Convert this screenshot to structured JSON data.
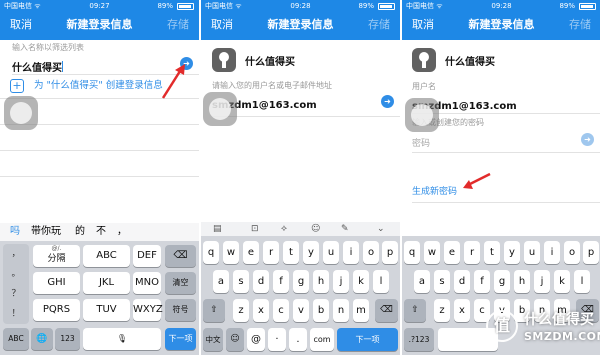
{
  "panels": [
    {
      "status": {
        "carrier": "中国电信 ᯤ",
        "time": "09:27",
        "battery": "89%"
      },
      "nav": {
        "cancel": "取消",
        "title": "新建登录信息",
        "save": "存储"
      },
      "field_label": "输入名称以筛选列表",
      "name_value": "什么值得买",
      "create_prefix": "为",
      "create_label": "\"什么值得买\" 创建登录信息",
      "candidates": [
        "吗",
        "带你玩",
        "的",
        "不",
        "，"
      ],
      "keys": {
        "left": [
          "，",
          "。",
          "？",
          "！"
        ],
        "grid": [
          {
            "top": "@/.",
            "bottom": "分隔"
          },
          {
            "top": "",
            "bottom": "ABC"
          },
          {
            "top": "",
            "bottom": "DEF"
          },
          {
            "top": "",
            "bottom": "GHI"
          },
          {
            "top": "",
            "bottom": "JKL"
          },
          {
            "top": "",
            "bottom": "MNO"
          },
          {
            "top": "",
            "bottom": "PQRS"
          },
          {
            "top": "",
            "bottom": "TUV"
          },
          {
            "top": "",
            "bottom": "WXYZ"
          }
        ],
        "right": [
          "⌫",
          "清空",
          "符号"
        ],
        "bottom": [
          "ABC",
          "🌐",
          "123",
          "🎙",
          "下一项"
        ]
      }
    },
    {
      "status": {
        "carrier": "中国电信 ᯤ",
        "time": "09:28",
        "battery": "89%"
      },
      "nav": {
        "cancel": "取消",
        "title": "新建登录信息",
        "save": "存储"
      },
      "app_name": "什么值得买",
      "username_hint": "请输入您的用户名或电子邮件地址",
      "username_value": "smzdm1@163.com",
      "toolbar": [
        "▤",
        "⊡",
        "⟡",
        "☺",
        "✎",
        "⌄"
      ],
      "rows": [
        [
          "q",
          "w",
          "e",
          "r",
          "t",
          "y",
          "u",
          "i",
          "o",
          "p"
        ],
        [
          "a",
          "s",
          "d",
          "f",
          "g",
          "h",
          "j",
          "k",
          "l"
        ],
        [
          "z",
          "x",
          "c",
          "v",
          "b",
          "n",
          "m"
        ]
      ],
      "bottom": [
        "中文",
        "☺",
        "@",
        "·",
        ".",
        "com",
        "下一项"
      ]
    },
    {
      "status": {
        "carrier": "中国电信 ᯤ",
        "time": "09:28",
        "battery": "89%"
      },
      "nav": {
        "cancel": "取消",
        "title": "新建登录信息",
        "save": "存储"
      },
      "app_name": "什么值得买",
      "username_label": "用户名",
      "username_value": "smzdm1@163.com",
      "password_hint": "输入或创建您的密码",
      "password_placeholder": "密码",
      "generate_link": "生成新密码",
      "rows": [
        [
          "q",
          "w",
          "e",
          "r",
          "t",
          "y",
          "u",
          "i",
          "o",
          "p"
        ],
        [
          "a",
          "s",
          "d",
          "f",
          "g",
          "h",
          "j",
          "k",
          "l"
        ],
        [
          "z",
          "x",
          "c",
          "v",
          "b",
          "n",
          "m"
        ]
      ],
      "bottom": [
        ".?123"
      ],
      "watermark": {
        "glyph": "值",
        "line1": "什么值得买",
        "line2": "SMZDM.COM"
      }
    }
  ]
}
